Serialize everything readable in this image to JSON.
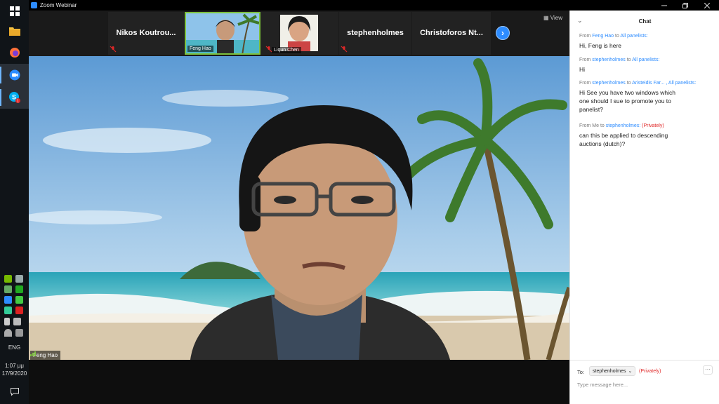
{
  "window": {
    "title": "Zoom Webinar",
    "controls": [
      "minimize",
      "restore",
      "close"
    ]
  },
  "taskbar": {
    "apps": [
      {
        "name": "windows-start",
        "icon": "windows-logo-icon"
      },
      {
        "name": "file-explorer",
        "icon": "folder-icon"
      },
      {
        "name": "firefox",
        "icon": "firefox-icon"
      },
      {
        "name": "zoom",
        "icon": "zoom-icon",
        "active": true
      },
      {
        "name": "skype",
        "icon": "skype-icon",
        "badge": "1"
      }
    ],
    "language": "ENG",
    "time": "1:07 μμ",
    "date": "17/9/2020"
  },
  "gallery": {
    "participants": [
      {
        "name": "Nikos Koutrou...",
        "muted": true,
        "video": false
      },
      {
        "name": "Feng Hao",
        "muted": false,
        "video": true,
        "active_speaker": true
      },
      {
        "name": "Liqun Chen",
        "muted": true,
        "video": true
      },
      {
        "name": "stephenholmes",
        "muted": true,
        "video": false
      },
      {
        "name": "Christoforos Nt...",
        "muted": false,
        "video": false
      }
    ],
    "view_label": "View",
    "next_label": "›"
  },
  "main_video": {
    "speaker_name": "Feng Hao"
  },
  "chat": {
    "title": "Chat",
    "collapse_icon": "chevron-down-icon",
    "messages": [
      {
        "from_label": "From",
        "sender": "Feng Hao",
        "to_label": "to",
        "recipient": "All panelists:",
        "text": "Hi, Feng is here"
      },
      {
        "from_label": "From",
        "sender": "stephenholmes",
        "to_label": "to",
        "recipient": "All panelists:",
        "text": "Hi"
      },
      {
        "from_label": "From",
        "sender": "stephenholmes",
        "to_label": "to",
        "recipient": "Aristeidis Far... , All panelists:",
        "text": "Hi See you have two windows which one should I sue to promote you to panelist?"
      },
      {
        "from_label": "From",
        "sender": "Me",
        "to_label": "to",
        "recipient": "stephenholmes:",
        "privacy": "(Privately)",
        "text": "can this be applied to descending auctions (dutch)?"
      }
    ],
    "compose": {
      "to_label": "To:",
      "to_value": "stephenholmes",
      "privacy": "(Privately)",
      "more_label": "···",
      "placeholder": "Type message here..."
    }
  },
  "colors": {
    "accent": "#2d8cff",
    "private": "#e02828",
    "taskbar": "#101418",
    "strip": "#1a1a1a"
  }
}
